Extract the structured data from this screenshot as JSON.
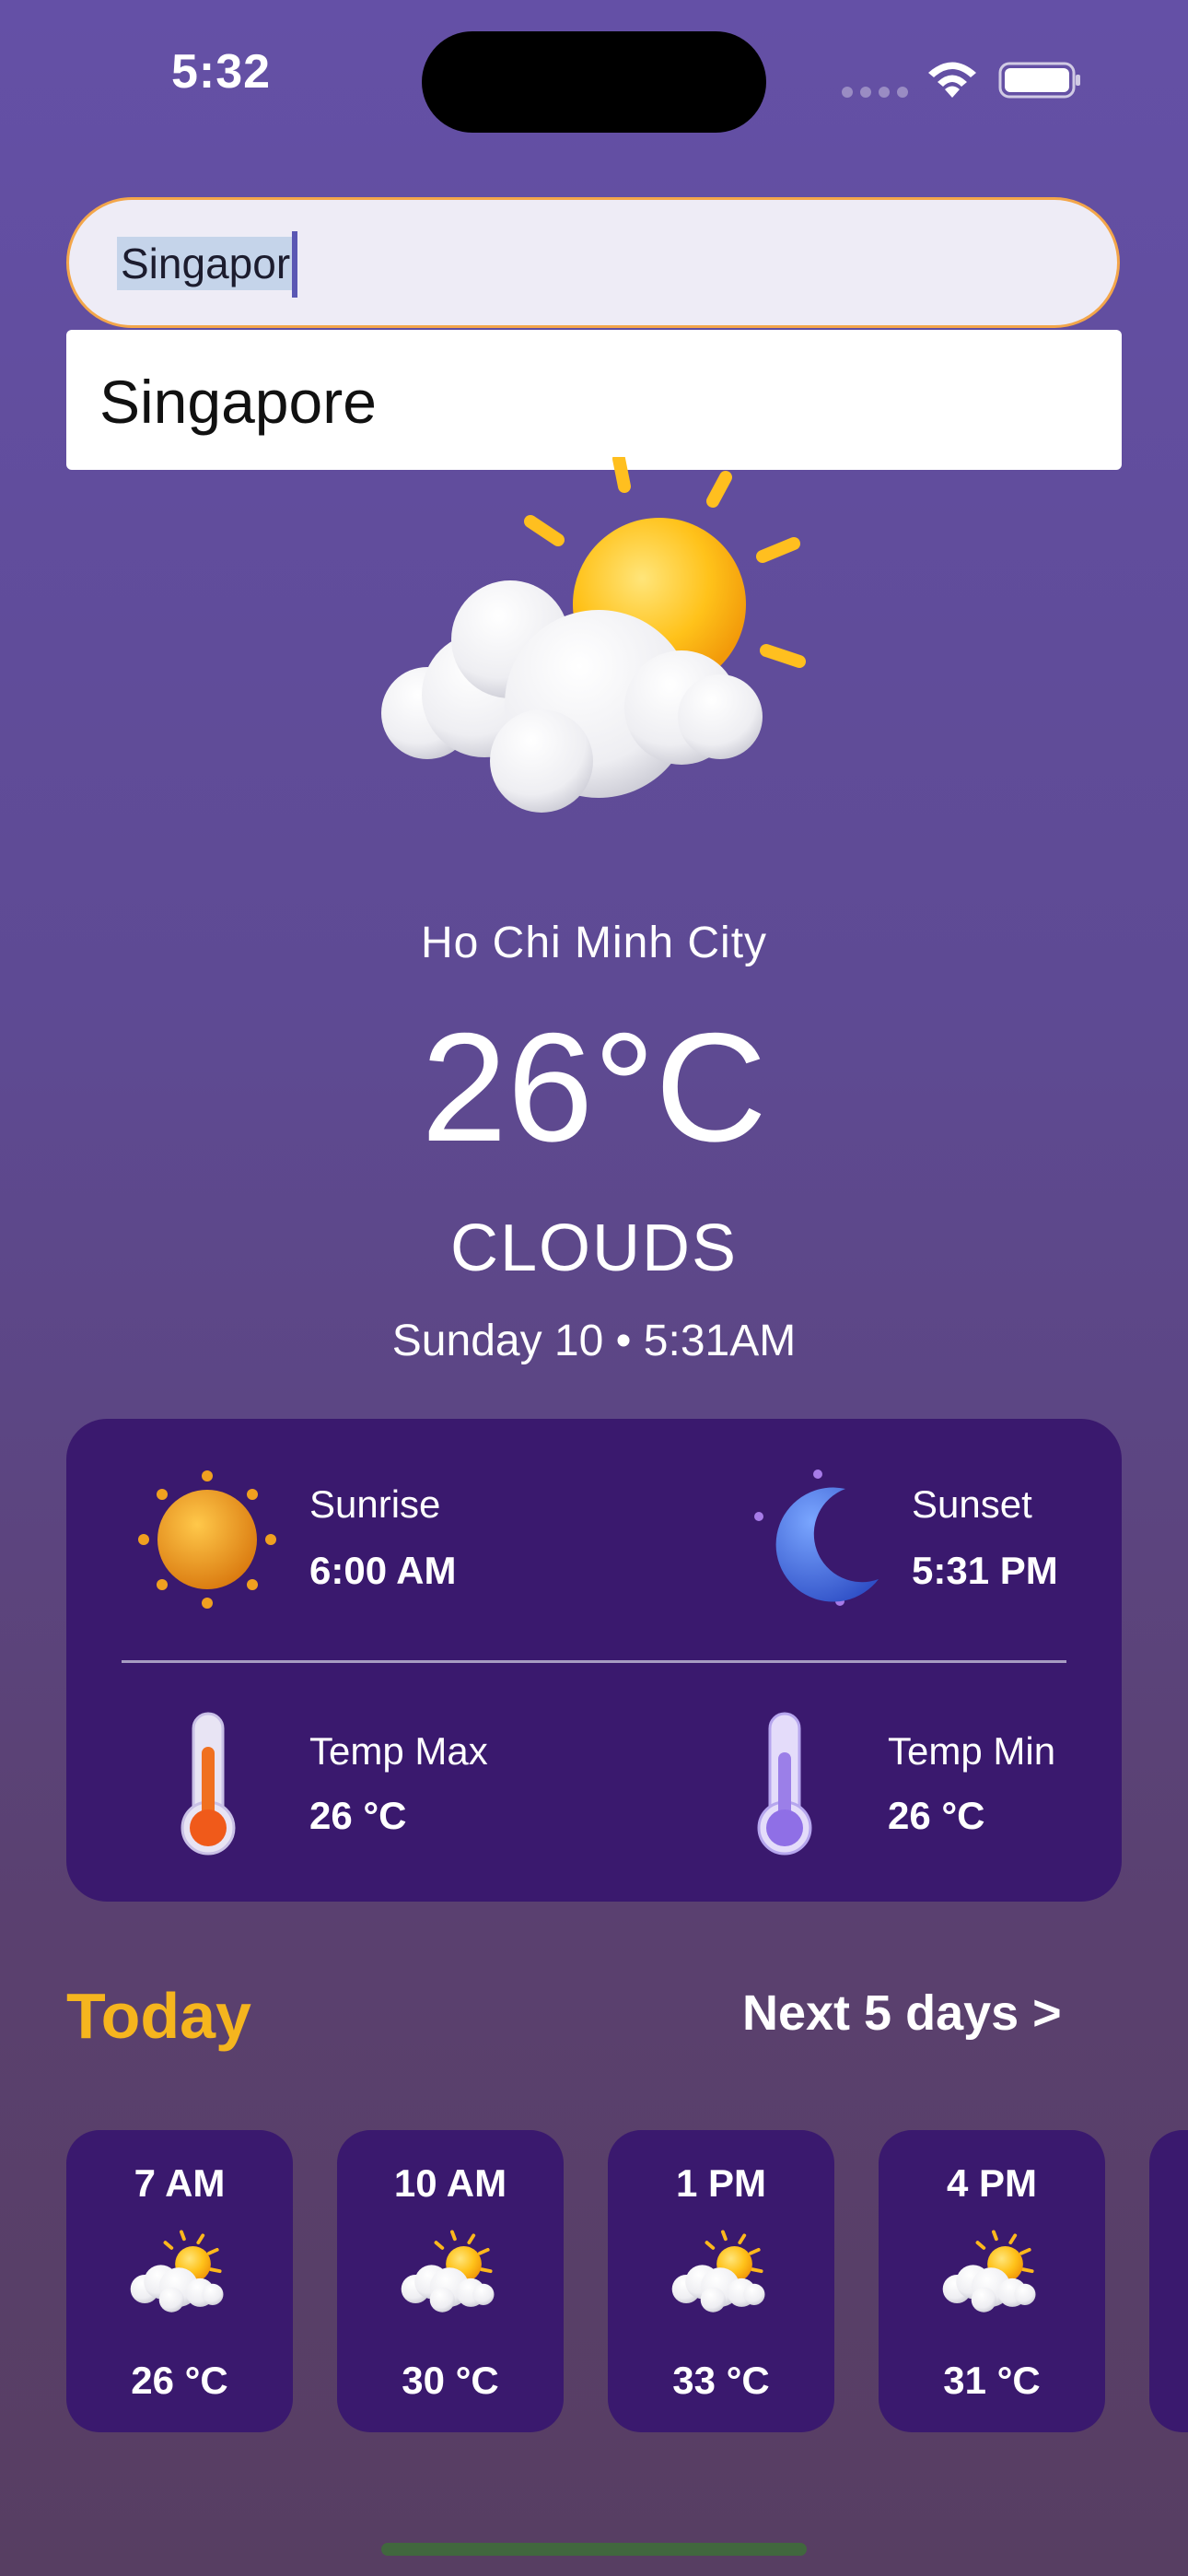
{
  "status_bar": {
    "time": "5:32"
  },
  "search": {
    "value": "Singapor",
    "suggestions": [
      "Singapore"
    ]
  },
  "current": {
    "city": "Ho Chi Minh City",
    "temperature": "26°C",
    "condition": "CLOUDS",
    "date_time": "Sunday 10 • 5:31AM",
    "icon": "sun-behind-cloud-icon"
  },
  "details": {
    "sunrise": {
      "label": "Sunrise",
      "value": "6:00 AM",
      "icon": "sun-icon"
    },
    "sunset": {
      "label": "Sunset",
      "value": "5:31 PM",
      "icon": "moon-icon"
    },
    "temp_max": {
      "label": "Temp Max",
      "value": "26 °C",
      "icon": "thermometer-hot-icon"
    },
    "temp_min": {
      "label": "Temp Min",
      "value": "26 °C",
      "icon": "thermometer-cold-icon"
    }
  },
  "forecast": {
    "title": "Today",
    "next_link": "Next 5 days >",
    "hours": [
      {
        "time": "7 AM",
        "temp": "26 °C",
        "icon": "sun-behind-cloud-icon"
      },
      {
        "time": "10 AM",
        "temp": "30 °C",
        "icon": "sun-behind-cloud-icon"
      },
      {
        "time": "1 PM",
        "temp": "33 °C",
        "icon": "sun-behind-cloud-icon"
      },
      {
        "time": "4 PM",
        "temp": "31 °C",
        "icon": "sun-behind-cloud-icon"
      }
    ]
  },
  "colors": {
    "accent_today": "#f5b51e",
    "card": "#3a196e",
    "search_border": "#f3a64a"
  }
}
